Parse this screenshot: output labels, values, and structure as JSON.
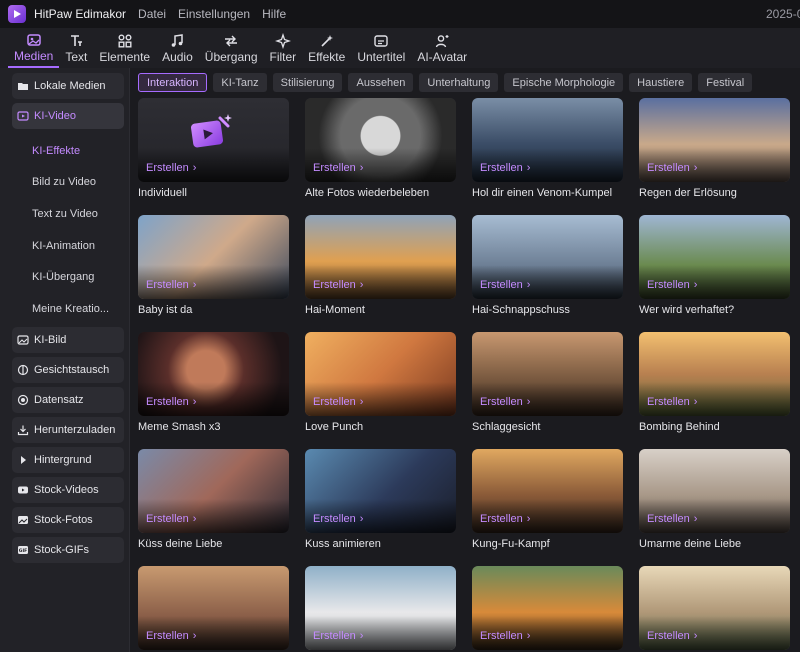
{
  "app": {
    "title": "HitPaw Edimakor",
    "menu": [
      "Datei",
      "Einstellungen",
      "Hilfe"
    ],
    "date_partial": "2025-0"
  },
  "toolbar": [
    {
      "label": "Medien",
      "icon": "media-icon",
      "active": true
    },
    {
      "label": "Text",
      "icon": "text-icon"
    },
    {
      "label": "Elemente",
      "icon": "elements-icon"
    },
    {
      "label": "Audio",
      "icon": "audio-icon"
    },
    {
      "label": "Übergang",
      "icon": "transition-icon"
    },
    {
      "label": "Filter",
      "icon": "filter-icon"
    },
    {
      "label": "Effekte",
      "icon": "effects-icon"
    },
    {
      "label": "Untertitel",
      "icon": "subtitle-icon"
    },
    {
      "label": "AI-Avatar",
      "icon": "avatar-icon"
    }
  ],
  "sidebar": {
    "top": [
      {
        "label": "Lokale Medien",
        "icon": "folder-icon"
      },
      {
        "label": "KI-Video",
        "icon": "ai-video-icon",
        "active": true
      }
    ],
    "sub": [
      {
        "label": "KI-Effekte",
        "active": true
      },
      {
        "label": "Bild zu Video"
      },
      {
        "label": "Text zu Video"
      },
      {
        "label": "KI-Animation"
      },
      {
        "label": "KI-Übergang"
      },
      {
        "label": "Meine Kreatio..."
      }
    ],
    "bottom": [
      {
        "label": "KI-Bild",
        "icon": "ai-image-icon"
      },
      {
        "label": "Gesichtstausch",
        "icon": "face-swap-icon"
      },
      {
        "label": "Datensatz",
        "icon": "dataset-icon"
      },
      {
        "label": "Herunterzuladen",
        "icon": "download-icon"
      },
      {
        "label": "Hintergrund",
        "icon": "background-icon"
      },
      {
        "label": "Stock-Videos",
        "icon": "stock-video-icon"
      },
      {
        "label": "Stock-Fotos",
        "icon": "stock-photo-icon"
      },
      {
        "label": "Stock-GIFs",
        "icon": "gif-icon"
      }
    ]
  },
  "filters": [
    "Interaktion",
    "KI-Tanz",
    "Stilisierung",
    "Aussehen",
    "Unterhaltung",
    "Epische Morphologie",
    "Haustiere",
    "Festival"
  ],
  "active_filter": "Interaktion",
  "create_label": "Erstellen",
  "cards": [
    {
      "title": "Individuell",
      "scene": "custom"
    },
    {
      "title": "Alte Fotos wiederbeleben",
      "scene": "bw"
    },
    {
      "title": "Hol dir einen Venom-Kumpel",
      "scene": "venom"
    },
    {
      "title": "Regen der Erlösung",
      "scene": "sky"
    },
    {
      "title": "Baby ist da",
      "scene": "baby"
    },
    {
      "title": "Hai-Moment",
      "scene": "sunset"
    },
    {
      "title": "Hai-Schnappschuss",
      "scene": "shark"
    },
    {
      "title": "Wer wird verhaftet?",
      "scene": "field"
    },
    {
      "title": "Meme Smash x3",
      "scene": "meme"
    },
    {
      "title": "Love Punch",
      "scene": "dog"
    },
    {
      "title": "Schlaggesicht",
      "scene": "warm"
    },
    {
      "title": "Bombing Behind",
      "scene": "bomb"
    },
    {
      "title": "Küss deine Liebe",
      "scene": "kiss"
    },
    {
      "title": "Kuss animieren",
      "scene": "kiss2"
    },
    {
      "title": "Kung-Fu-Kampf",
      "scene": "kungfu"
    },
    {
      "title": "Umarme deine Liebe",
      "scene": "hug"
    },
    {
      "title": "",
      "scene": "group"
    },
    {
      "title": "",
      "scene": "bear"
    },
    {
      "title": "",
      "scene": "tiger"
    },
    {
      "title": "",
      "scene": "jesus"
    }
  ],
  "colors": {
    "accent": "#c48bff",
    "background": "#1b1b1f",
    "sidebar": "#222227"
  }
}
